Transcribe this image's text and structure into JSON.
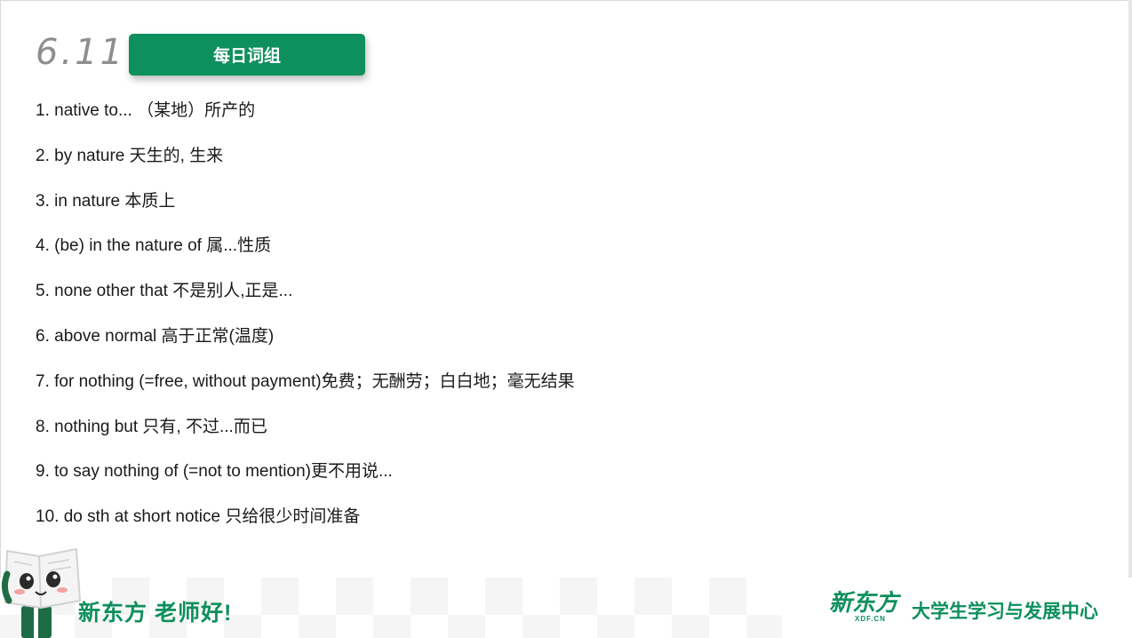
{
  "header": {
    "date": "6.11",
    "title": "每日词组"
  },
  "phrases": [
    "1. native to... （某地）所产的",
    "2. by nature 天生的, 生来",
    "3. in nature 本质上",
    "4. (be) in the nature of 属...性质",
    "5. none other that 不是别人,正是...",
    "6. above normal 高于正常(温度)",
    "7. for nothing (=free, without payment)免费；无酬劳；白白地；毫无结果",
    "8. nothing but 只有, 不过...而已",
    "9. to say nothing of (=not to mention)更不用说...",
    "10. do sth at short notice 只给很少时间准备"
  ],
  "footer": {
    "slogan": "新东方 老师好!",
    "logo_text": "新东方",
    "logo_sub": "XDF.CN",
    "org_name": "大学生学习与发展中心"
  },
  "colors": {
    "brand_green": "#0d8f5e",
    "date_gray": "#8e8e8e",
    "text": "#1a1a1a"
  },
  "icons": {
    "mascot": "book-mascot-icon"
  }
}
